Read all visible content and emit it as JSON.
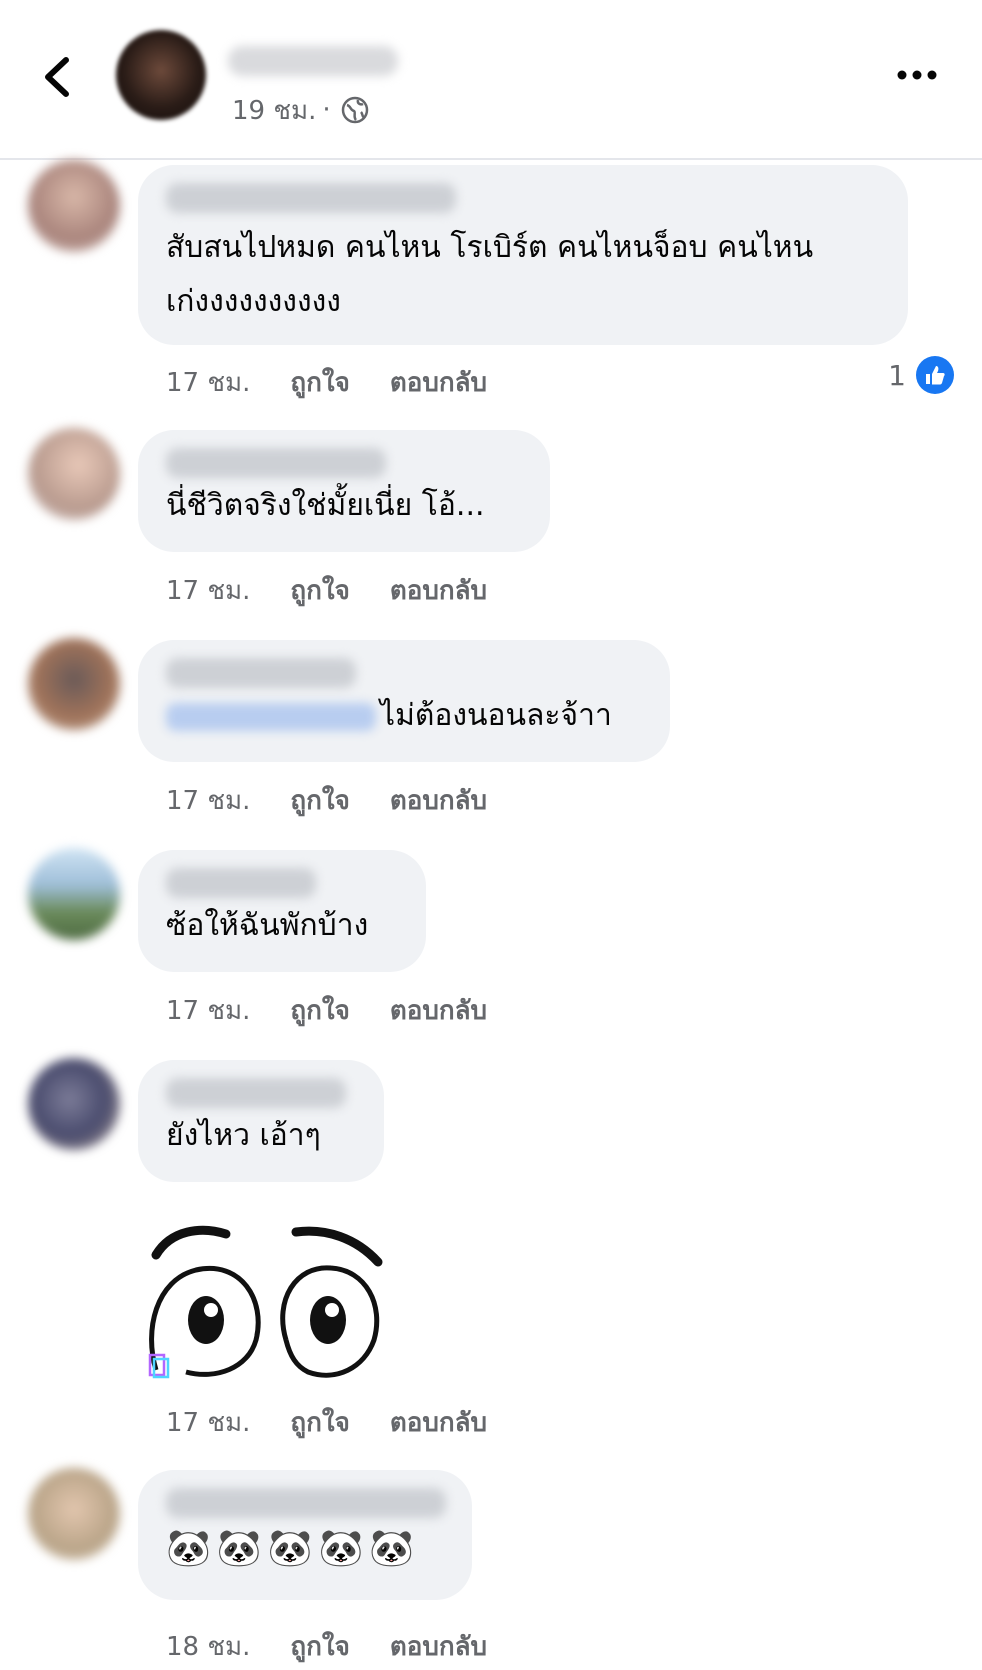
{
  "header": {
    "time": "19 ชม.",
    "separator": "·"
  },
  "comments": [
    {
      "text": "สับสนไปหมด คนไหน โรเบิร์ต คนไหนจ็อบ คนไหน\nเก่งงงงงงงงงง",
      "time": "17 ชม.",
      "like_label": "ถูกใจ",
      "reply_label": "ตอบกลับ",
      "reaction_count": "1"
    },
    {
      "text": "นี่ชีวิตจริงใช่มั้ยเนี่ย โอ้...",
      "time": "17 ชม.",
      "like_label": "ถูกใจ",
      "reply_label": "ตอบกลับ"
    },
    {
      "text": "ไม่ต้องนอนละจ้าา",
      "time": "17 ชม.",
      "like_label": "ถูกใจ",
      "reply_label": "ตอบกลับ"
    },
    {
      "text": "ซ้อให้ฉันพักบ้าง",
      "time": "17 ชม.",
      "like_label": "ถูกใจ",
      "reply_label": "ตอบกลับ"
    },
    {
      "text": "ยังไหว เอ้าๆ",
      "time": "17 ชม.",
      "like_label": "ถูกใจ",
      "reply_label": "ตอบกลับ"
    },
    {
      "sticker": "wide-eyes-sticker",
      "time": "17 ชม.",
      "like_label": "ถูกใจ",
      "reply_label": "ตอบกลับ"
    },
    {
      "text": "🐼🐼🐼🐼🐼",
      "time": "18 ชม.",
      "like_label": "ถูกใจ",
      "reply_label": "ตอบกลับ"
    }
  ],
  "colors": {
    "bubble": "#f0f2f5",
    "meta": "#65676b",
    "like_blue": "#1877f2"
  }
}
